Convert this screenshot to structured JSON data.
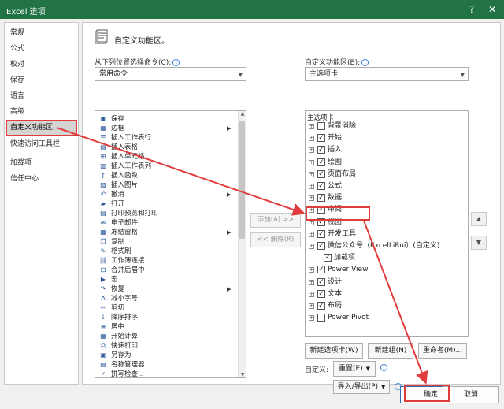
{
  "window": {
    "title": "Excel 选项",
    "help_label": "?",
    "close_label": "✕"
  },
  "nav": {
    "items": [
      {
        "label": "常规"
      },
      {
        "label": "公式"
      },
      {
        "label": "校对"
      },
      {
        "label": "保存"
      },
      {
        "label": "语言"
      },
      {
        "label": "高级"
      },
      {
        "label": "自定义功能区",
        "selected": true
      },
      {
        "label": "快速访问工具栏"
      },
      {
        "label": "加载项"
      },
      {
        "label": "信任中心"
      }
    ]
  },
  "header": {
    "title": "自定义功能区。",
    "icon": "customize-ribbon-icon"
  },
  "left_panel": {
    "label": "从下列位置选择命令(C):",
    "info": "i",
    "select_value": "常用命令",
    "commands": [
      {
        "label": "保存",
        "icon": "save-icon",
        "glyph": "▣"
      },
      {
        "label": "边框",
        "icon": "border-icon",
        "glyph": "▦",
        "submenu": true
      },
      {
        "label": "插入工作表行",
        "icon": "insert-row-icon",
        "glyph": "☰"
      },
      {
        "label": "插入表格",
        "icon": "insert-table-icon",
        "glyph": "▤"
      },
      {
        "label": "插入单元格...",
        "icon": "insert-cell-icon",
        "glyph": "⊞"
      },
      {
        "label": "插入工作表列",
        "icon": "insert-column-icon",
        "glyph": "▥"
      },
      {
        "label": "插入函数...",
        "icon": "function-icon",
        "glyph": "ƒ"
      },
      {
        "label": "插入图片",
        "icon": "picture-icon",
        "glyph": "▨"
      },
      {
        "label": "撤消",
        "icon": "undo-icon",
        "glyph": "↶",
        "submenu": true
      },
      {
        "label": "打开",
        "icon": "open-folder-icon",
        "glyph": "▰"
      },
      {
        "label": "打印预览和打印",
        "icon": "print-preview-icon",
        "glyph": "▤"
      },
      {
        "label": "电子邮件",
        "icon": "email-icon",
        "glyph": "✉"
      },
      {
        "label": "冻结窗格",
        "icon": "freeze-panes-icon",
        "glyph": "▦",
        "submenu": true
      },
      {
        "label": "复制",
        "icon": "copy-icon",
        "glyph": "❐"
      },
      {
        "label": "格式刷",
        "icon": "format-painter-icon",
        "glyph": "✎"
      },
      {
        "label": "工作簿连接",
        "icon": "connections-icon",
        "glyph": "⛓"
      },
      {
        "label": "合并后居中",
        "icon": "merge-center-icon",
        "glyph": "⊟"
      },
      {
        "label": "宏",
        "icon": "macro-icon",
        "glyph": "▶"
      },
      {
        "label": "恢复",
        "icon": "redo-icon",
        "glyph": "↷",
        "submenu": true
      },
      {
        "label": "减小字号",
        "icon": "decrease-font-icon",
        "glyph": "A"
      },
      {
        "label": "剪切",
        "icon": "cut-icon",
        "glyph": "✂"
      },
      {
        "label": "降序排序",
        "icon": "sort-desc-icon",
        "glyph": "↓"
      },
      {
        "label": "居中",
        "icon": "center-icon",
        "glyph": "≡"
      },
      {
        "label": "开始计算",
        "icon": "calculate-icon",
        "glyph": "▦"
      },
      {
        "label": "快速打印",
        "icon": "quick-print-icon",
        "glyph": "⎙"
      },
      {
        "label": "另存为",
        "icon": "save-as-icon",
        "glyph": "▣"
      },
      {
        "label": "名称管理器",
        "icon": "name-manager-icon",
        "glyph": "▤"
      },
      {
        "label": "拼写检查...",
        "icon": "spellcheck-icon",
        "glyph": "✓"
      }
    ]
  },
  "middle": {
    "add_label": "添加(A) >>",
    "remove_label": "<< 删除(R)"
  },
  "right_panel": {
    "label": "自定义功能区(B):",
    "info": "i",
    "select_value": "主选项卡",
    "tree_header": "主选项卡",
    "tree": [
      {
        "label": "背景消除",
        "checked": false,
        "indent": 0
      },
      {
        "label": "开始",
        "checked": true,
        "indent": 0
      },
      {
        "label": "插入",
        "checked": true,
        "indent": 0
      },
      {
        "label": "绘图",
        "checked": true,
        "indent": 0
      },
      {
        "label": "页面布局",
        "checked": true,
        "indent": 0
      },
      {
        "label": "公式",
        "checked": true,
        "indent": 0
      },
      {
        "label": "数据",
        "checked": true,
        "indent": 0
      },
      {
        "label": "审阅",
        "checked": true,
        "indent": 0
      },
      {
        "label": "视图",
        "checked": true,
        "indent": 0
      },
      {
        "label": "开发工具",
        "checked": true,
        "indent": 0,
        "highlight": true
      },
      {
        "label": "微信公众号（ExcelLiRui）(自定义)",
        "checked": true,
        "indent": 0
      },
      {
        "label": "加载项",
        "checked": true,
        "indent": 1
      },
      {
        "label": "Power View",
        "checked": true,
        "indent": 0
      },
      {
        "label": "设计",
        "checked": true,
        "indent": 0
      },
      {
        "label": "文本",
        "checked": true,
        "indent": 0
      },
      {
        "label": "布局",
        "checked": true,
        "indent": 0
      },
      {
        "label": "Power Pivot",
        "checked": false,
        "indent": 0
      }
    ],
    "new_tab_label": "新建选项卡(W)",
    "new_group_label": "新建组(N)",
    "rename_label": "重命名(M)...",
    "customize_label": "自定义:",
    "reset_label": "重置(E)",
    "import_export_label": "导入/导出(P)"
  },
  "footer": {
    "ok_label": "确定",
    "cancel_label": "取消"
  },
  "colors": {
    "title_bar": "#217346",
    "annotation_red": "#e23b3b",
    "primary_border": "#2b6cb5"
  }
}
